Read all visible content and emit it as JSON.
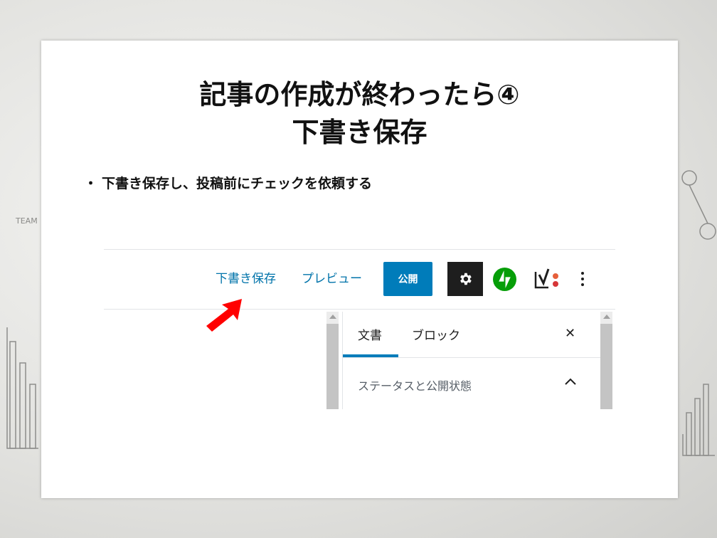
{
  "slide": {
    "title_line1": "記事の作成が終わったら④",
    "title_line2": "下書き保存",
    "bullet_marker": "・",
    "bullet_text": "下書き保存し、投稿前にチェックを依頼する"
  },
  "background": {
    "doodle_text": "TEAM"
  },
  "editor": {
    "toolbar": {
      "save_draft_label": "下書き保存",
      "preview_label": "プレビュー",
      "publish_label": "公開",
      "settings_icon": "gear-icon",
      "jetpack_icon": "jetpack-icon",
      "yoast_icon": "yoast-icon",
      "more_icon": "more-vertical-icon",
      "accent_color": "#007cba"
    },
    "sidebar": {
      "tabs": [
        {
          "label": "文書",
          "active": true
        },
        {
          "label": "ブロック",
          "active": false
        }
      ],
      "close_icon": "close-icon",
      "section_label": "ステータスと公開状態",
      "section_expanded": true
    }
  },
  "annotation": {
    "pointer": "red-arrow-icon",
    "color": "#ff0000"
  }
}
